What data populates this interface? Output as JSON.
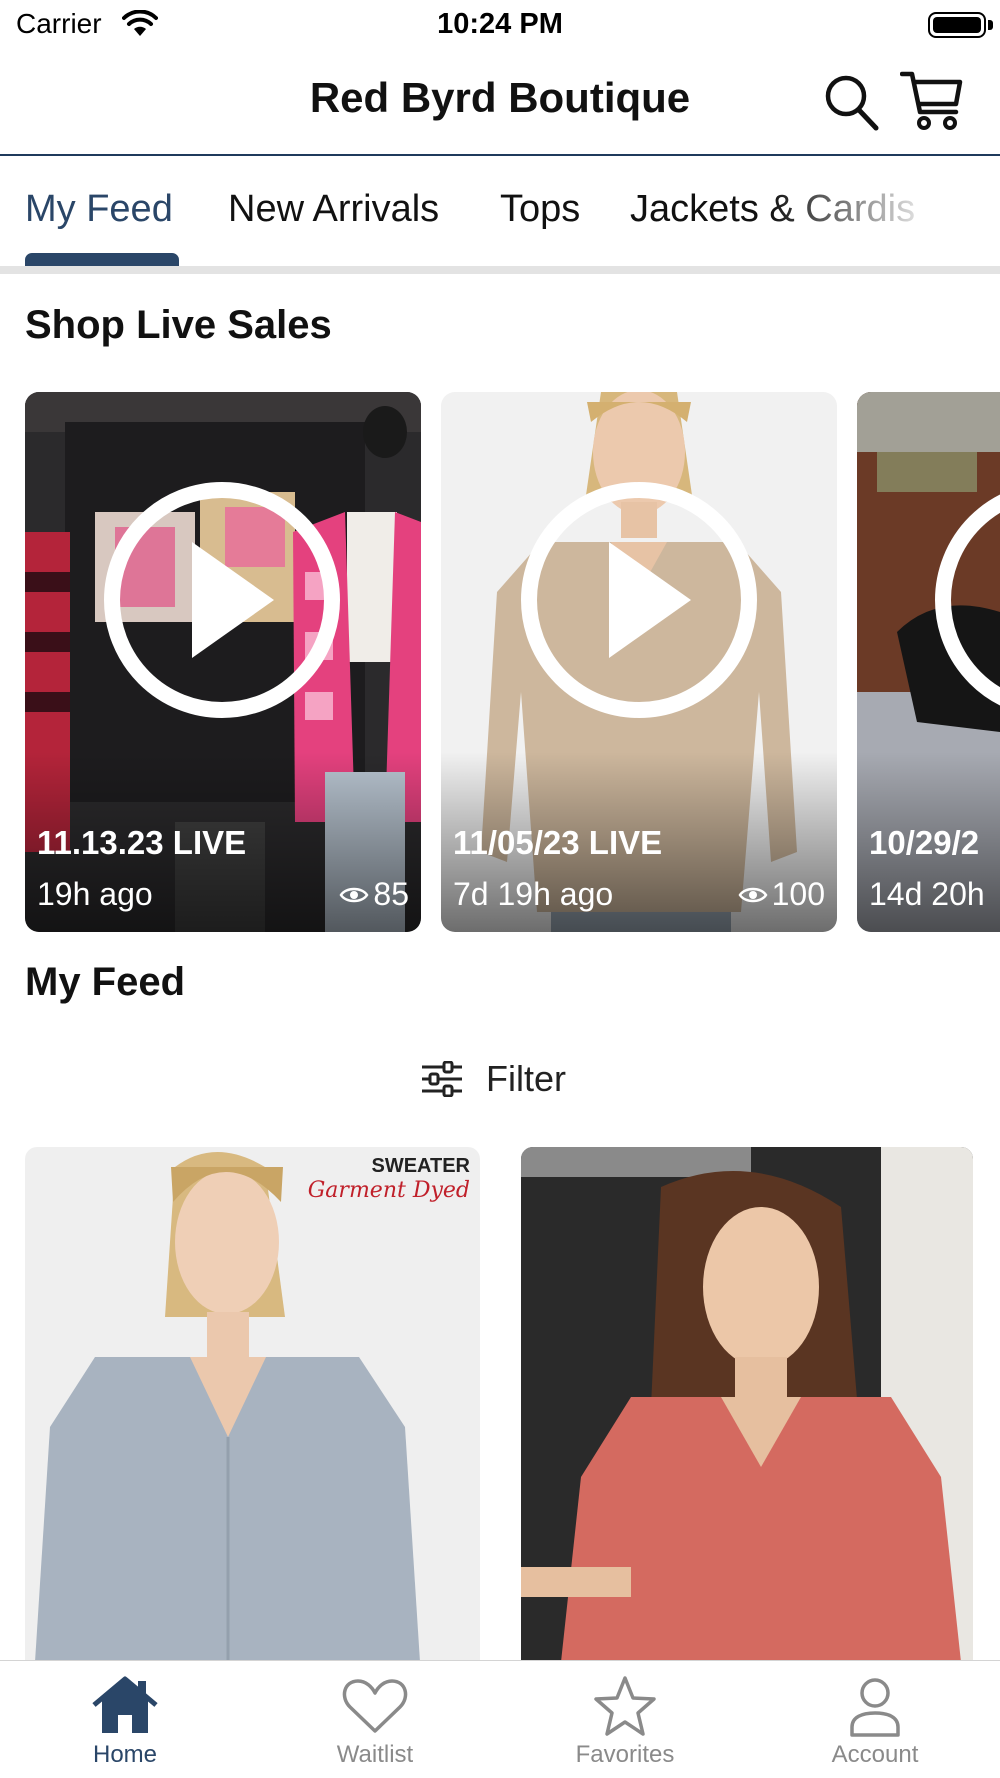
{
  "status_bar": {
    "carrier": "Carrier",
    "time": "10:24 PM"
  },
  "header": {
    "title": "Red Byrd Boutique",
    "search_icon": "search-icon",
    "cart_icon": "cart-icon"
  },
  "tabs": [
    {
      "label": "My Feed",
      "active": true
    },
    {
      "label": "New Arrivals",
      "active": false
    },
    {
      "label": "Tops",
      "active": false
    },
    {
      "label": "Jackets & Cardis",
      "active": false
    }
  ],
  "live_section": {
    "title": "Shop Live Sales",
    "items": [
      {
        "title": "11.13.23 LIVE",
        "ago": "19h ago",
        "views": "85"
      },
      {
        "title": "11/05/23 LIVE",
        "ago": "7d 19h ago",
        "views": "100"
      },
      {
        "title": "10/29/2",
        "ago": "14d 20h",
        "views": ""
      }
    ]
  },
  "feed_section": {
    "title": "My Feed",
    "filter_label": "Filter",
    "products": [
      {
        "badge_line1": "SWEATER",
        "badge_line2": "Garment Dyed"
      },
      {
        "badge_line1": "",
        "badge_line2": ""
      }
    ]
  },
  "bottom_nav": [
    {
      "label": "Home",
      "icon": "home-icon",
      "active": true
    },
    {
      "label": "Waitlist",
      "icon": "heart-icon",
      "active": false
    },
    {
      "label": "Favorites",
      "icon": "star-icon",
      "active": false
    },
    {
      "label": "Account",
      "icon": "person-icon",
      "active": false
    }
  ],
  "colors": {
    "accent": "#2a4668",
    "inactive": "#8a8a8a",
    "divider": "#e3e3e3"
  }
}
